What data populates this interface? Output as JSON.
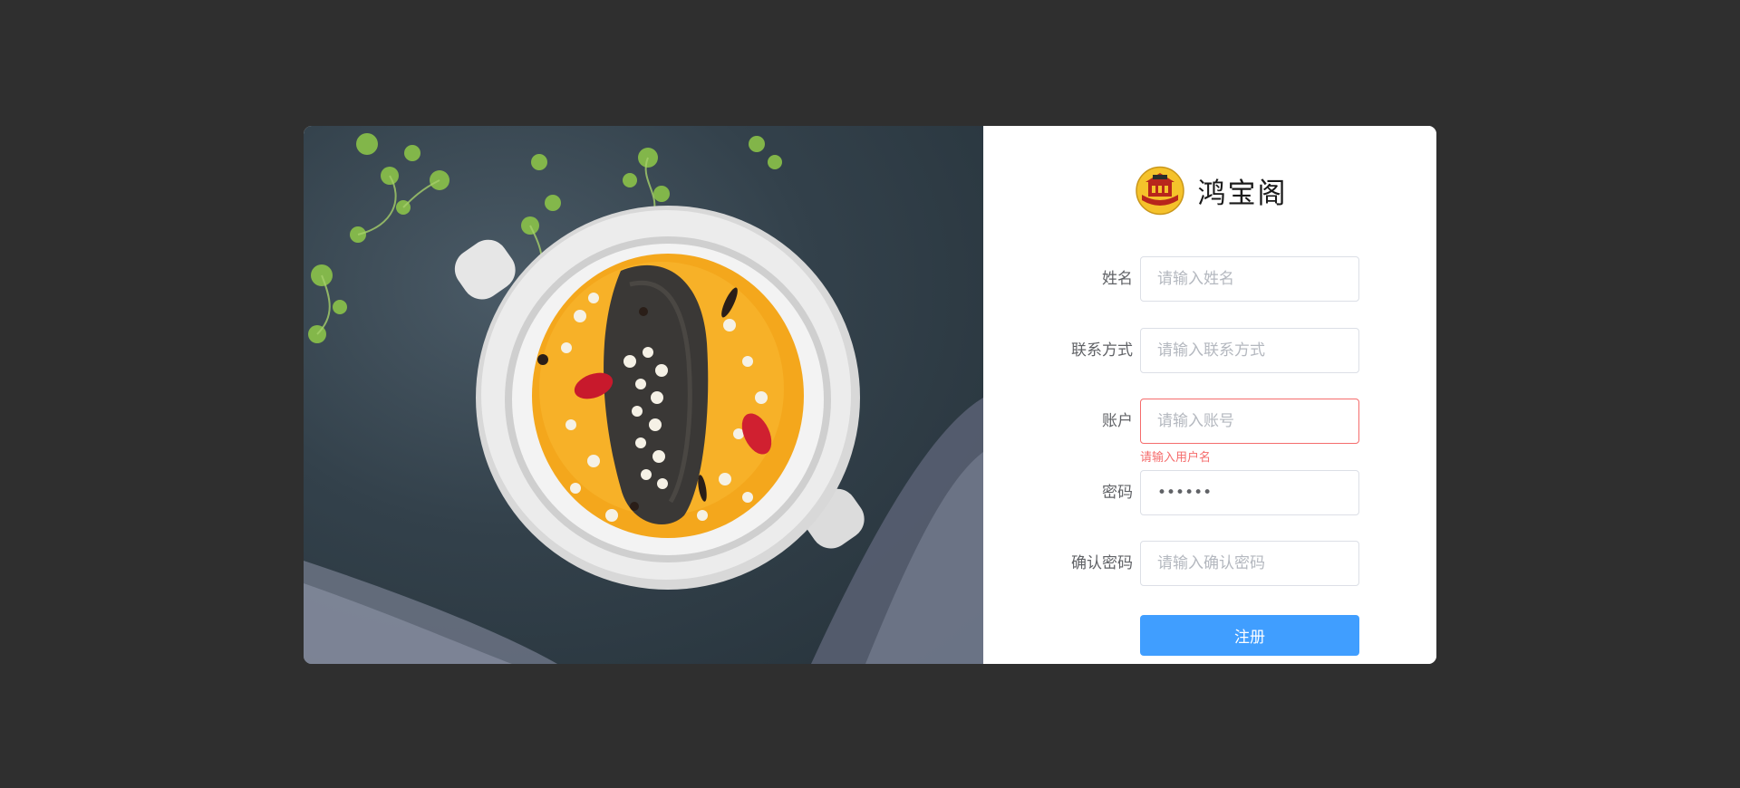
{
  "brand": {
    "name": "鸿宝阁",
    "logo_text": "HOTEL"
  },
  "form": {
    "fields": [
      {
        "label": "姓名",
        "placeholder": "请输入姓名",
        "value": ""
      },
      {
        "label": "联系方式",
        "placeholder": "请输入联系方式",
        "value": ""
      },
      {
        "label": "账户",
        "placeholder": "请输入账号",
        "value": "",
        "error": "请输入用户名"
      },
      {
        "label": "密码",
        "placeholder": "",
        "value": "••••••"
      },
      {
        "label": "确认密码",
        "placeholder": "请输入确认密码",
        "value": ""
      }
    ],
    "submit_label": "注册"
  },
  "colors": {
    "page_bg": "#2f2f2f",
    "primary": "#409eff",
    "error": "#f56c6c",
    "photo_bg": "#33414b",
    "soup": "#f4a71c"
  },
  "icons": {
    "brand_logo": "hotel-logo-icon"
  }
}
